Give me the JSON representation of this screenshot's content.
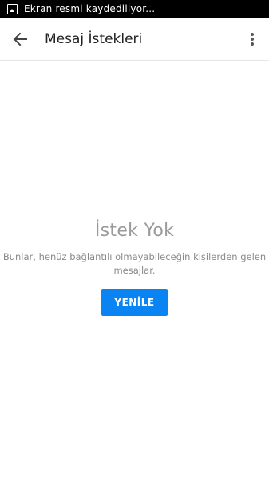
{
  "status_bar": {
    "icon": "screenshot-icon",
    "text": "Ekran resmi kaydediliyor..."
  },
  "app_bar": {
    "back_icon": "arrow-back-icon",
    "title": "Mesaj İstekleri",
    "overflow_icon": "more-vert-icon"
  },
  "empty_state": {
    "title": "İstek Yok",
    "description": "Bunlar, henüz bağlantılı olmayabileceğin kişilerden gelen mesajlar.",
    "refresh_label": "YENİLE"
  },
  "colors": {
    "accent": "#0a84f3",
    "status_bar": "#000000",
    "muted_text": "#9a9a9a"
  }
}
